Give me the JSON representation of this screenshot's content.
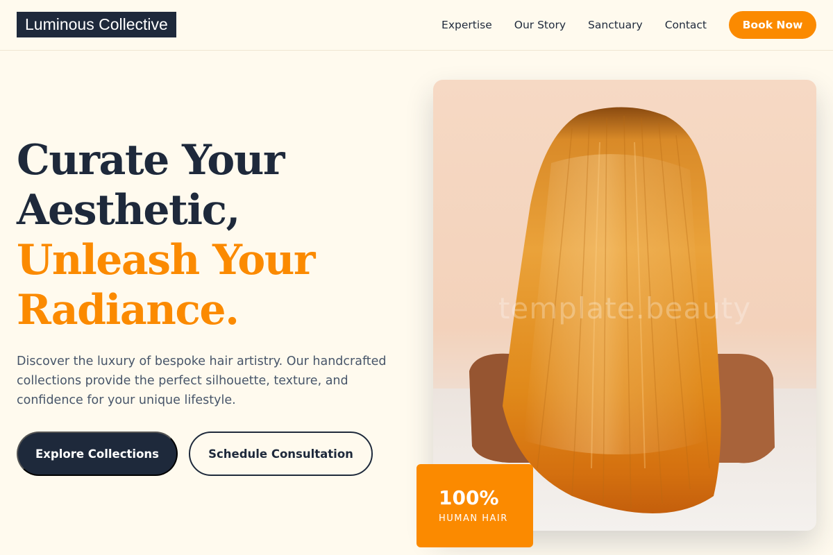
{
  "header": {
    "logo": "Luminous Collective",
    "nav": [
      "Expertise",
      "Our Story",
      "Sanctuary",
      "Contact"
    ],
    "cta": "Book Now"
  },
  "hero": {
    "headline_line1": "Curate Your",
    "headline_line2": "Aesthetic,",
    "headline_line3": "Unleash Your",
    "headline_line4": "Radiance.",
    "description": "Discover the luxury of bespoke hair artistry. Our handcrafted collections provide the perfect silhouette, texture, and confidence for your unique lifestyle.",
    "primary_button": "Explore Collections",
    "secondary_button": "Schedule Consultation",
    "image_watermark": "template.beauty"
  },
  "stat": {
    "value": "100%",
    "label": "HUMAN HAIR"
  },
  "colors": {
    "background": "#fffaee",
    "navy": "#1e293b",
    "accent": "#fb8a00",
    "body_text": "#475569"
  }
}
